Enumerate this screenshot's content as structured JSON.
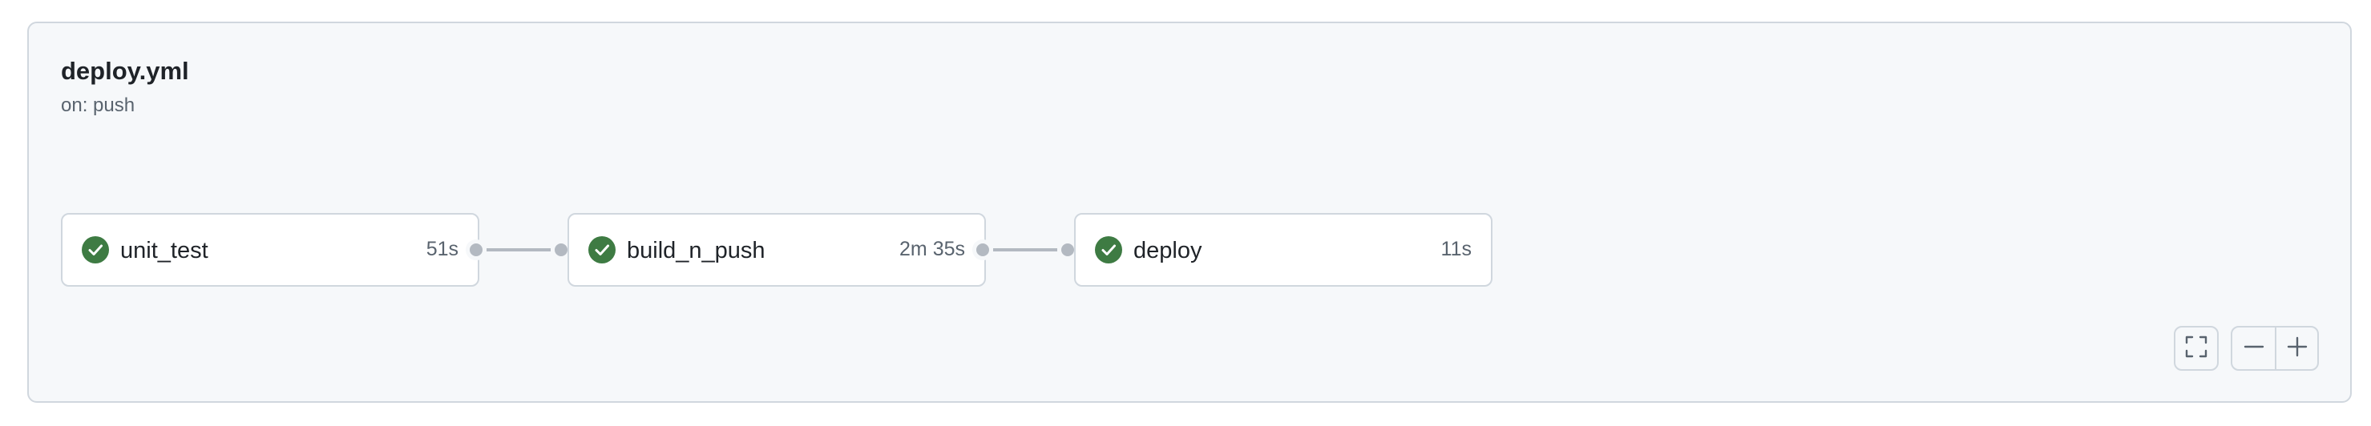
{
  "workflow": {
    "title": "deploy.yml",
    "trigger": "on: push"
  },
  "jobs": [
    {
      "name": "unit_test",
      "duration": "51s",
      "status": "success",
      "status_icon": "check-circle-icon"
    },
    {
      "name": "build_n_push",
      "duration": "2m 35s",
      "status": "success",
      "status_icon": "check-circle-icon"
    },
    {
      "name": "deploy",
      "duration": "11s",
      "status": "success",
      "status_icon": "check-circle-icon"
    }
  ],
  "controls": {
    "fullscreen_icon": "fullscreen-icon",
    "zoom_out_icon": "minus-icon",
    "zoom_in_icon": "plus-icon"
  },
  "colors": {
    "success": "#3e7b43",
    "panel_bg": "#f6f8fa",
    "border": "#d0d7de",
    "connector": "#b3b9c1",
    "text_primary": "#1f2328",
    "text_muted": "#59636e"
  }
}
